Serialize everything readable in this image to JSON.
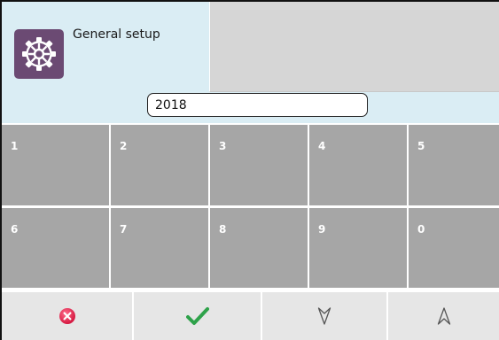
{
  "header": {
    "title": "General setup",
    "icon": "gear-icon",
    "icon_bg_color": "#6b4a73"
  },
  "input": {
    "value": "2018"
  },
  "keypad": {
    "keys": [
      "1",
      "2",
      "3",
      "4",
      "5",
      "6",
      "7",
      "8",
      "9",
      "0"
    ]
  },
  "actions": [
    {
      "name": "cancel",
      "icon": "cancel-icon",
      "color": "#e8254f"
    },
    {
      "name": "confirm",
      "icon": "checkmark-icon",
      "color": "#2ea24a"
    },
    {
      "name": "down",
      "icon": "arrow-down-icon",
      "color": "#555555"
    },
    {
      "name": "up",
      "icon": "arrow-up-icon",
      "color": "#555555"
    }
  ]
}
